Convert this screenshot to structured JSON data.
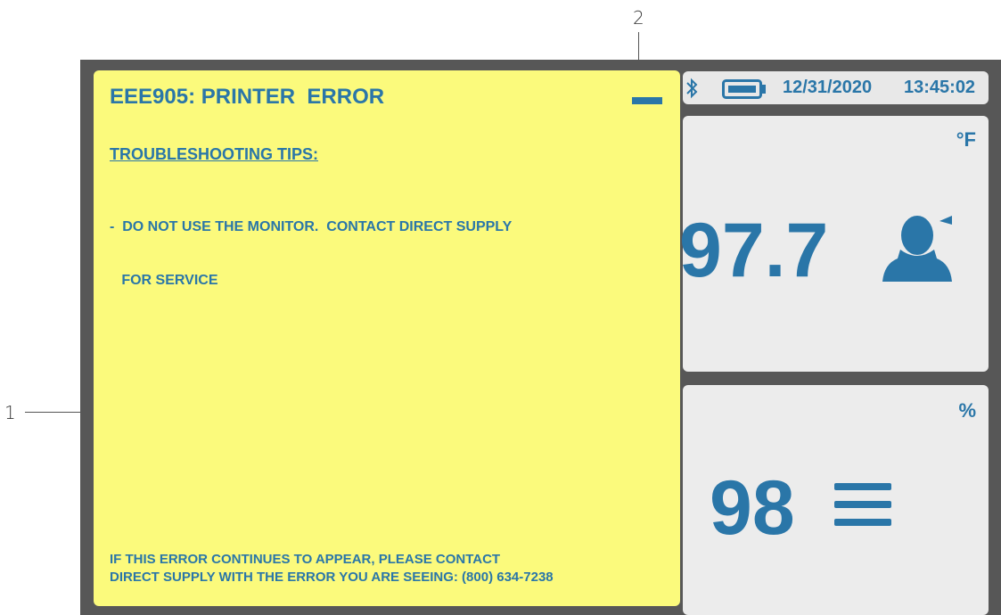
{
  "callouts": {
    "one": "1",
    "two": "2"
  },
  "status": {
    "date": "12/31/2020",
    "time": "13:45:02"
  },
  "temperature": {
    "value": "97.7",
    "unit": "°F"
  },
  "spo2": {
    "value": "98",
    "unit": "%"
  },
  "error": {
    "title": "EEE905: PRINTER  ERROR",
    "tips_heading": "TROUBLESHOOTING TIPS:",
    "tip_line1": "-  DO NOT USE THE MONITOR.  CONTACT DIRECT SUPPLY",
    "tip_line2": "   FOR SERVICE",
    "footer_line1": "IF THIS ERROR CONTINUES TO APPEAR, PLEASE CONTACT",
    "footer_line2": "DIRECT SUPPLY WITH THE ERROR YOU ARE SEEING: (800) 634-7238"
  },
  "colors": {
    "accent": "#2a76a8",
    "dialog": "#fbfa7c",
    "bezel": "#575757",
    "panel": "#ececec"
  },
  "icons": [
    "bluetooth-icon",
    "battery-icon",
    "patient-head-icon",
    "menu-icon",
    "minimize-icon"
  ]
}
